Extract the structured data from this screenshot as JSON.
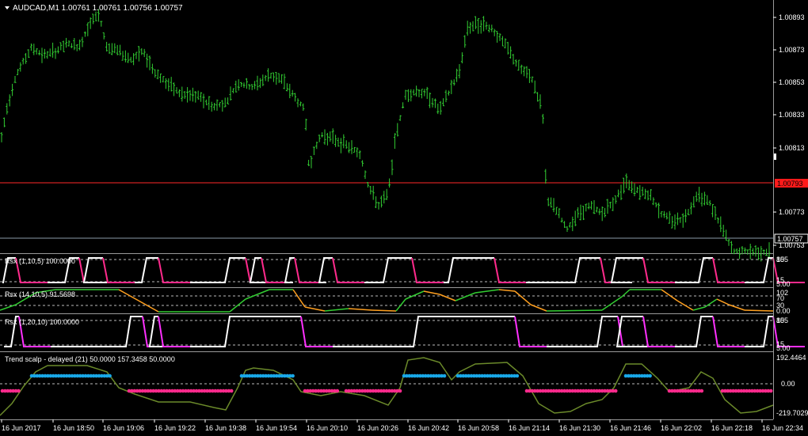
{
  "main": {
    "symbol": "AUDCAD,M1",
    "ohlc": "1.00761 1.00761 1.00756 1.00757",
    "title": "AUDCAD,M1  1.00761 1.00761 1.00756 1.00757",
    "price_labels": [
      "1.00893",
      "1.00873",
      "1.00853",
      "1.00833",
      "1.00813",
      "1.00773",
      "1.00753"
    ],
    "red_level_label": "1.00793",
    "current_price_label": "1.00757",
    "bar_color": "#32cd32",
    "red_line_color": "#ff2a2a"
  },
  "panels": [
    {
      "title": "Rsx (1,10,5) 100.0000",
      "scale": [
        "105",
        "85",
        "15",
        "5.00"
      ]
    },
    {
      "title": "Rsx (14,10,5) 91.5698",
      "scale": [
        "102",
        "70",
        "30",
        "0.00"
      ]
    },
    {
      "title": "Rsx (1,20,10) 100.0000",
      "scale": [
        "105",
        "85",
        "15",
        "5.00"
      ]
    },
    {
      "title": "Trend scalp - delayed (21) 50.0000 157.3458 50.0000",
      "scale": [
        "192.4464",
        "0.00",
        "-219.7029"
      ]
    }
  ],
  "time_axis": [
    "16 Jun 2017",
    "16 Jun 18:50",
    "16 Jun 19:06",
    "16 Jun 19:22",
    "16 Jun 19:38",
    "16 Jun 19:54",
    "16 Jun 20:10",
    "16 Jun 20:26",
    "16 Jun 20:42",
    "16 Jun 20:58",
    "16 Jun 21:14",
    "16 Jun 21:30",
    "16 Jun 21:46",
    "16 Jun 22:02",
    "16 Jun 22:18",
    "16 Jun 22:34"
  ],
  "colors": {
    "white_line": "#ffffff",
    "pink_line": "#ff2a8c",
    "green_line": "#32cd32",
    "orange_line": "#ffa020",
    "magenta_line": "#ff30ff",
    "cyan_dots": "#19a8e8",
    "trend_line": "#6b8a2a"
  }
}
